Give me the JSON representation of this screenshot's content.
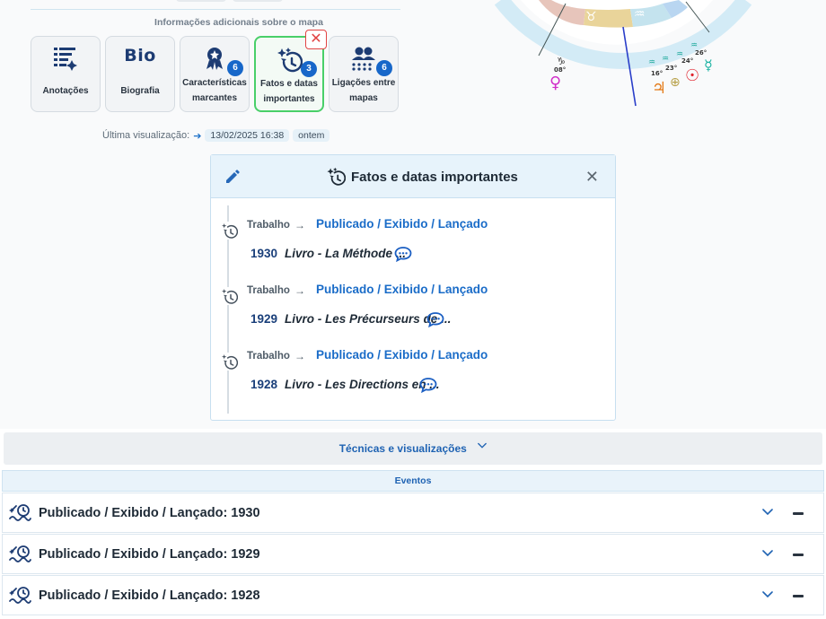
{
  "info_section": {
    "title": "Informações adicionais sobre o mapa",
    "cards": [
      {
        "label": "Anotações",
        "icon": "notes-icon"
      },
      {
        "label": "Biografia",
        "icon": "bio-icon",
        "icon_text": "Bio"
      },
      {
        "label": "Características marcantes",
        "icon": "award-icon",
        "count": "6"
      },
      {
        "label": "Fatos e datas importantes",
        "icon": "history-sparkle-icon",
        "count": "3",
        "active": true
      },
      {
        "label": "Ligações entre mapas",
        "icon": "people-links-icon",
        "count": "6"
      }
    ],
    "close_symbol": "✕"
  },
  "last_view": {
    "label": "Última visualização:",
    "date": "13/02/2025 16:38",
    "relative": "ontem"
  },
  "chart_fragment": {
    "degree_labels": [
      "08°",
      "16°",
      "23°",
      "24°",
      "26°"
    ],
    "glyphs": [
      "♑",
      "♀",
      "♃",
      "⊕",
      "☉",
      "☿",
      "♒",
      "♉"
    ]
  },
  "panel": {
    "title": "Fatos e datas importantes",
    "close_symbol": "✕",
    "entries": [
      {
        "category": "Trabalho",
        "arrow": "→",
        "type": "Publicado / Exibido / Lançado",
        "year": "1930",
        "description": "Livro - La Méthode ..."
      },
      {
        "category": "Trabalho",
        "arrow": "→",
        "type": "Publicado / Exibido / Lançado",
        "year": "1929",
        "description": "Livro - Les Précurseurs de ..."
      },
      {
        "category": "Trabalho",
        "arrow": "→",
        "type": "Publicado / Exibido / Lançado",
        "year": "1928",
        "description": "Livro - Les Directions en ..."
      }
    ]
  },
  "techniques": {
    "label": "Técnicas e visualizações"
  },
  "events": {
    "header": "Eventos",
    "rows": [
      {
        "title": "Publicado / Exibido / Lançado: 1930"
      },
      {
        "title": "Publicado / Exibido / Lançado: 1929"
      },
      {
        "title": "Publicado / Exibido / Lançado: 1928"
      }
    ]
  },
  "colors": {
    "accent_blue": "#1a6cc8",
    "active_green": "#49cf69",
    "badge_blue": "#1767c9",
    "close_red": "#e24343"
  }
}
